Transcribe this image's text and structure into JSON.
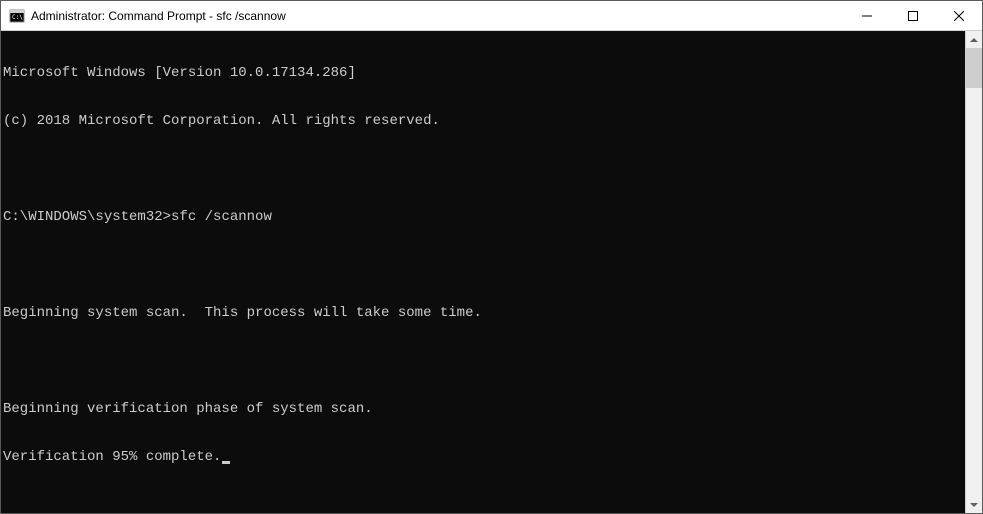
{
  "window": {
    "title": "Administrator: Command Prompt - sfc  /scannow"
  },
  "terminal": {
    "line1": "Microsoft Windows [Version 10.0.17134.286]",
    "line2": "(c) 2018 Microsoft Corporation. All rights reserved.",
    "blank1": "",
    "prompt_path": "C:\\WINDOWS\\system32>",
    "prompt_command": "sfc /scannow",
    "blank2": "",
    "line_scan": "Beginning system scan.  This process will take some time.",
    "blank3": "",
    "line_verify": "Beginning verification phase of system scan.",
    "line_progress": "Verification 95% complete."
  }
}
